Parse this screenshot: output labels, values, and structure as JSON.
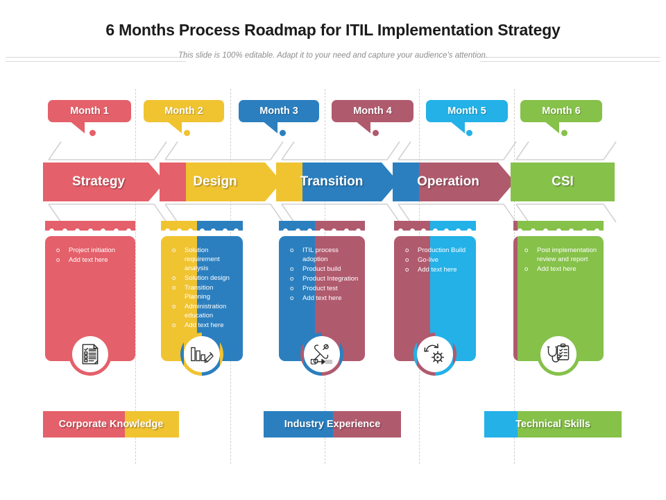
{
  "header": {
    "title": "6 Months Process Roadmap for ITIL Implementation Strategy",
    "subtitle": "This slide is 100% editable. Adapt it to your need and capture your audience's attention."
  },
  "palette": {
    "red": "#E4606A",
    "yellow": "#F0C331",
    "blue": "#2B7FBF",
    "mauve": "#B05A6E",
    "cyan": "#23B1E8",
    "green": "#86C14A",
    "outline": "#D2D2D2",
    "divider": "#CFCFCF"
  },
  "months": [
    {
      "label": "Month 1",
      "color": "#E4606A"
    },
    {
      "label": "Month 2",
      "color": "#F0C331"
    },
    {
      "label": "Month 3",
      "color": "#2B7FBF"
    },
    {
      "label": "Month 4",
      "color": "#B05A6E"
    },
    {
      "label": "Month 5",
      "color": "#23B1E8"
    },
    {
      "label": "Month 6",
      "color": "#86C14A"
    }
  ],
  "stages": [
    {
      "label": "Strategy",
      "color": "#E4606A",
      "next_color": "#F0C331",
      "icon": "checklist-icon",
      "bullets": [
        "Project initiation",
        "Add text here"
      ]
    },
    {
      "label": "Design",
      "color": "#F0C331",
      "next_color": "#2B7FBF",
      "icon": "bar-chart-pencil-icon",
      "bullets": [
        "Solution requirement analysis",
        "Solution  design",
        "Transition  Planning",
        "Administration education",
        "Add text here"
      ]
    },
    {
      "label": "Transition",
      "color": "#2B7FBF",
      "next_color": "#B05A6E",
      "icon": "tools-arrow-icon",
      "bullets": [
        "ITIL process adoption",
        "Product build",
        "Product Integration",
        "Product test",
        "Add text here"
      ]
    },
    {
      "label": "Operation",
      "color": "#B05A6E",
      "next_color": "#23B1E8",
      "icon": "gear-refresh-icon",
      "bullets": [
        "Production  Build",
        "Go-live",
        "Add text here"
      ]
    },
    {
      "label": "CSI",
      "color": "#86C14A",
      "next_color": "",
      "icon": "stethoscope-clipboard-icon",
      "bullets": [
        "Post implementation review and  report",
        "Add text here"
      ]
    }
  ],
  "categories": [
    {
      "label": "Corporate Knowledge",
      "left_color": "#E4606A",
      "right_color": "#F0C331"
    },
    {
      "label": "Industry Experience",
      "left_color": "#2B7FBF",
      "right_color": "#B05A6E"
    },
    {
      "label": "Technical Skills",
      "left_color": "#23B1E8",
      "right_color": "#86C14A"
    }
  ]
}
